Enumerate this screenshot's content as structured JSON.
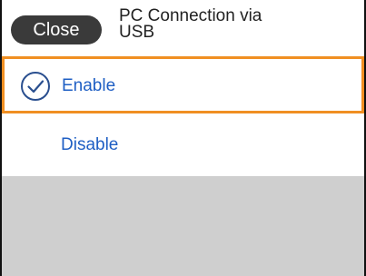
{
  "header": {
    "close_label": "Close",
    "title_line1": "PC Connection via",
    "title_line2": "USB"
  },
  "options": [
    {
      "label": "Enable",
      "selected": true,
      "icon": "checkmark-circle-icon"
    },
    {
      "label": "Disable",
      "selected": false
    }
  ],
  "colors": {
    "accent_selection": "#f08f22",
    "option_text": "#1f5fc4",
    "button_bg": "#3a3a3a",
    "empty_area": "#cfcfcf"
  }
}
